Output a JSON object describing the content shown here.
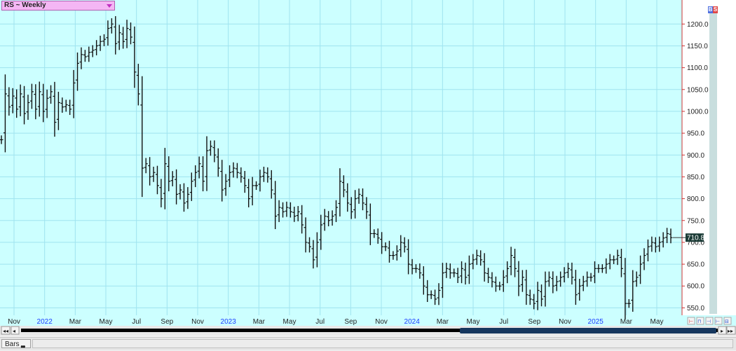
{
  "window": {
    "symbol_title": "RS ~ Weekly"
  },
  "badges": {
    "b": "B",
    "s": "S"
  },
  "bottom_tabs": {
    "bars_label": "Bars"
  },
  "chart_data": {
    "type": "ohlc",
    "title": "RS ~ Weekly",
    "xlabel": "",
    "ylabel": "",
    "ylim": [
      533,
      1255
    ],
    "y_ticks": [
      "1200.0",
      "1150.0",
      "1100.0",
      "1050.0",
      "1000.0",
      "950.0",
      "900.0",
      "850.0",
      "800.0",
      "750.0",
      "700.0",
      "650.0",
      "600.0",
      "550.0"
    ],
    "x_tick_labels": [
      {
        "label": "Nov",
        "year": false
      },
      {
        "label": "2022",
        "year": true
      },
      {
        "label": "Mar",
        "year": false
      },
      {
        "label": "May",
        "year": false
      },
      {
        "label": "Jul",
        "year": false
      },
      {
        "label": "Sep",
        "year": false
      },
      {
        "label": "Nov",
        "year": false
      },
      {
        "label": "2023",
        "year": true
      },
      {
        "label": "Mar",
        "year": false
      },
      {
        "label": "May",
        "year": false
      },
      {
        "label": "Jul",
        "year": false
      },
      {
        "label": "Sep",
        "year": false
      },
      {
        "label": "Nov",
        "year": false
      },
      {
        "label": "2024",
        "year": true
      },
      {
        "label": "Mar",
        "year": false
      },
      {
        "label": "May",
        "year": false
      },
      {
        "label": "Jul",
        "year": false
      },
      {
        "label": "Sep",
        "year": false
      },
      {
        "label": "Nov",
        "year": false
      },
      {
        "label": "2025",
        "year": true
      },
      {
        "label": "Mar",
        "year": false
      },
      {
        "label": "May",
        "year": false
      }
    ],
    "last_price_label": "710.8",
    "last_price": 710.8,
    "grid": true,
    "colors": {
      "background": "#ccffff",
      "grid": "#9fe3ef",
      "bars": "#111111",
      "axis_line": "#cc3333",
      "year_label": "#1a3cff",
      "badge_blue": "#5070e0",
      "badge_red": "#e04848",
      "scroll_thumb": "#16375e"
    },
    "series": [
      {
        "weeks": "weekly bars, late Oct 2021 to Jun 2025",
        "closes": [
          935,
          1040,
          1010,
          1035,
          1005,
          1040,
          995,
          1020,
          1045,
          1005,
          1045,
          1000,
          1030,
          1045,
          975,
          1020,
          1010,
          1015,
          1005,
          1065,
          1110,
          1130,
          1125,
          1135,
          1140,
          1150,
          1160,
          1165,
          1190,
          1200,
          1155,
          1180,
          1160,
          1190,
          1170,
          1090,
          1040,
          870,
          880,
          850,
          860,
          830,
          800,
          880,
          840,
          850,
          810,
          820,
          790,
          810,
          840,
          860,
          880,
          840,
          910,
          920,
          900,
          870,
          820,
          840,
          860,
          870,
          860,
          850,
          830,
          800,
          830,
          830,
          850,
          860,
          850,
          820,
          760,
          780,
          770,
          780,
          770,
          760,
          770,
          740,
          700,
          690,
          660,
          700,
          740,
          760,
          750,
          760,
          780,
          840,
          820,
          790,
          770,
          800,
          810,
          790,
          770,
          720,
          720,
          710,
          690,
          690,
          670,
          670,
          680,
          700,
          690,
          650,
          640,
          640,
          630,
          600,
          580,
          580,
          570,
          590,
          630,
          640,
          630,
          630,
          620,
          640,
          620,
          650,
          660,
          670,
          660,
          630,
          620,
          610,
          600,
          600,
          620,
          640,
          670,
          640,
          600,
          620,
          580,
          570,
          560,
          590,
          570,
          610,
          620,
          600,
          610,
          620,
          630,
          640,
          620,
          580,
          600,
          610,
          620,
          620,
          640,
          640,
          640,
          650,
          660,
          660,
          670,
          640,
          560,
          560,
          610,
          620,
          650,
          670,
          690,
          700,
          690,
          700,
          710,
          720,
          710.8
        ]
      }
    ]
  }
}
